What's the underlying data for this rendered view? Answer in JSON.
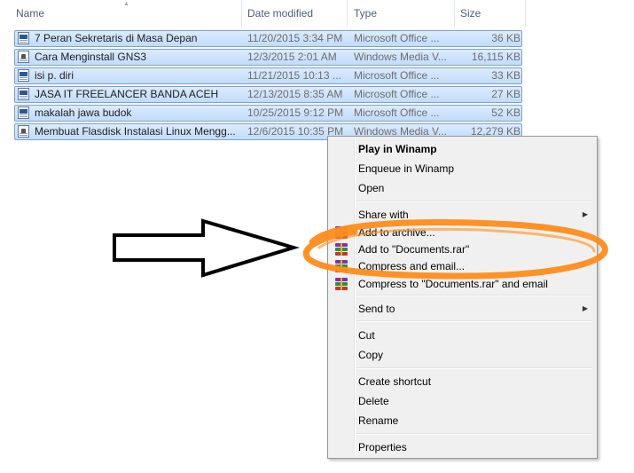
{
  "columns": {
    "name": "Name",
    "date_modified": "Date modified",
    "type": "Type",
    "size": "Size"
  },
  "files": [
    {
      "name": "7 Peran Sekretaris di Masa Depan",
      "date": "11/20/2015 3:34 PM",
      "type": "Microsoft Office ...",
      "size": "36 KB",
      "icon": "word-document-icon"
    },
    {
      "name": "Cara Menginstall GNS3",
      "date": "12/3/2015 2:01 AM",
      "type": "Windows Media V...",
      "size": "16,115 KB",
      "icon": "media-file-icon"
    },
    {
      "name": "isi p. diri",
      "date": "11/21/2015 10:13 ...",
      "type": "Microsoft Office ...",
      "size": "33 KB",
      "icon": "word-document-icon"
    },
    {
      "name": "JASA IT FREELANCER BANDA ACEH",
      "date": "12/13/2015 8:35 AM",
      "type": "Microsoft Office ...",
      "size": "27 KB",
      "icon": "word-document-icon"
    },
    {
      "name": "makalah jawa budok",
      "date": "10/25/2015 9:12 PM",
      "type": "Microsoft Office ...",
      "size": "52 KB",
      "icon": "word-document-icon"
    },
    {
      "name": "Membuat Flasdisk Instalasi Linux Mengg...",
      "date": "12/6/2015 10:35 PM",
      "type": "Windows Media V...",
      "size": "12,279 KB",
      "icon": "media-file-icon"
    }
  ],
  "context_menu": {
    "play_winamp": "Play in Winamp",
    "enqueue_winamp": "Enqueue in Winamp",
    "open": "Open",
    "share_with": "Share with",
    "add_archive": "Add to archive...",
    "add_documents_rar": "Add to \"Documents.rar\"",
    "compress_email": "Compress and email...",
    "compress_documents_email": "Compress to \"Documents.rar\" and email",
    "send_to": "Send to",
    "cut": "Cut",
    "copy": "Copy",
    "create_shortcut": "Create shortcut",
    "delete": "Delete",
    "rename": "Rename",
    "properties": "Properties"
  },
  "colors": {
    "selection_fill": "#c1dcfc",
    "selection_border": "#7da2ce",
    "annotation_orange": "#ff8c1a",
    "menu_bg": "#f0f0f0"
  }
}
